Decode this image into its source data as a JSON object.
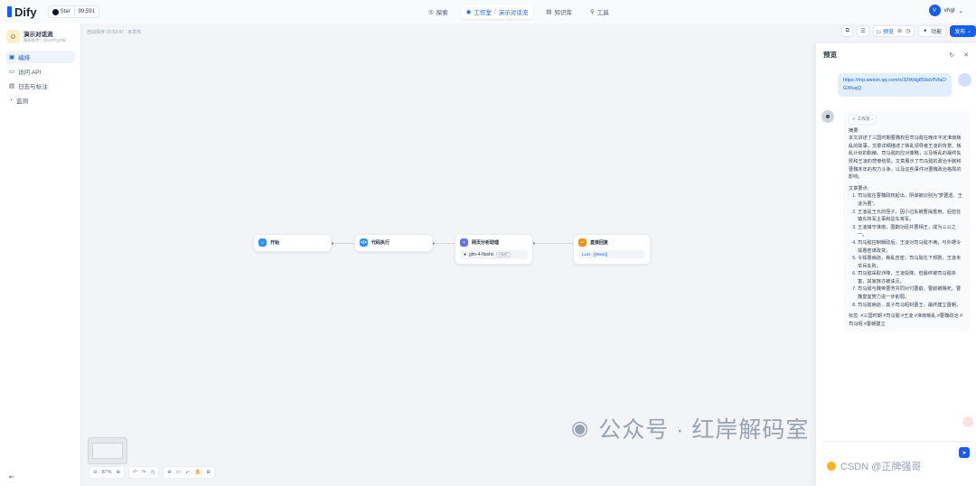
{
  "app": {
    "logo_text": "Dify"
  },
  "github": {
    "label": "Star",
    "count": "99,591"
  },
  "nav": {
    "explore": "探索",
    "studio": "工作室",
    "app_crumb": "演示对话流",
    "knowledge": "知识库",
    "tools": "工具"
  },
  "user": {
    "initial": "V",
    "name": "vhgl"
  },
  "sidebar": {
    "app_name": "演示对话流",
    "app_desc": "偏乐助手 · CHATFLOW",
    "items": [
      {
        "label": "编排",
        "icon": "orchestrate-icon",
        "active": true
      },
      {
        "label": "访问 API",
        "icon": "api-icon",
        "active": false
      },
      {
        "label": "日志与标注",
        "icon": "logs-icon",
        "active": false
      },
      {
        "label": "监测",
        "icon": "monitor-icon",
        "active": false
      }
    ]
  },
  "canvas": {
    "autosave": "自动保存 15:53:47 · 未发布",
    "zoom": "87%"
  },
  "toolbar": {
    "preview": "预览",
    "features": "功能",
    "publish": "发布"
  },
  "nodes": [
    {
      "title": "开始",
      "color": "#2e90fa"
    },
    {
      "title": "代码执行",
      "color": "#2e90fa"
    },
    {
      "title": "网页分析助理",
      "color": "#6172f3",
      "model": "glm-4-flashx",
      "model_tag": "CHAT"
    },
    {
      "title": "直接回复",
      "color": "#f79009",
      "sub": "LLM · {{#text}}"
    }
  ],
  "preview_panel": {
    "title": "预览",
    "user_message": "https://mp.weixin.qq.com/s/32Wdg859aVfVfaOGXfuqQ",
    "workflow_tag": "工作流",
    "reply": {
      "label": "摘要:",
      "summary": "本文讲述了三国时期曹魏权臣司马懿在晚年平定淮南叛乱的故事。文章详细描述了叛乱领导者王凌的背景、叛乱计划的酝酿、司马懿的应对策略，以及叛乱的最终失败和王凌的悲惨结局。文章展示了司马懿的政治手腕和曹魏末年的权力斗争，以及这些事件对曹魏政治格局的影响。",
      "points_label": "文章要点:",
      "points": [
        "司马懿在曹魏政权起出，阴谋被识别为“梦曹遗、王凌为曹”。",
        "王凌是王允的侄子，因小过失被曹操重用，后担任镇东将军主事和驻东将军。",
        "王凌镇守淮南，围剿功臣并曹相王，成为三公之一。",
        "司马懿控制朝政后，王凌对司马懿不满，与外甥令狐愚密谋政变。",
        "令狐愚病逝，叛乱告密，司马懿在下邳剧，王凌未举兵失败。",
        "司马懿采取诈降，王凌投降，但最终被司马懿杀害，其家族亦被诛灭。",
        "司马懿与魏帝曹芳共同对付曹叡，曹叡被赐死，曹魏皇室势力进一步削弱。",
        "司马懿病逝，其子司马昭封晋王，最终建立晋朝。"
      ],
      "tags": "标签: #三国时期 #司马懿 #王凌 #淮南叛乱 #曹魏政治 #司马昭 #晋朝建立"
    }
  },
  "watermark": {
    "text": "公众号 · 红岸解码室",
    "csdn": "CSDN @正牌强哥"
  }
}
